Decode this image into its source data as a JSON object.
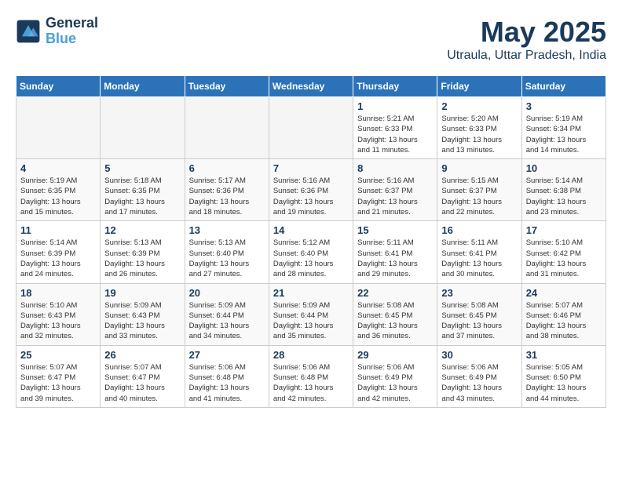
{
  "header": {
    "logo_line1": "General",
    "logo_line2": "Blue",
    "title": "May 2025",
    "subtitle": "Utraula, Uttar Pradesh, India"
  },
  "days_of_week": [
    "Sunday",
    "Monday",
    "Tuesday",
    "Wednesday",
    "Thursday",
    "Friday",
    "Saturday"
  ],
  "weeks": [
    [
      {
        "num": "",
        "info": ""
      },
      {
        "num": "",
        "info": ""
      },
      {
        "num": "",
        "info": ""
      },
      {
        "num": "",
        "info": ""
      },
      {
        "num": "1",
        "info": "Sunrise: 5:21 AM\nSunset: 6:33 PM\nDaylight: 13 hours\nand 11 minutes."
      },
      {
        "num": "2",
        "info": "Sunrise: 5:20 AM\nSunset: 6:33 PM\nDaylight: 13 hours\nand 13 minutes."
      },
      {
        "num": "3",
        "info": "Sunrise: 5:19 AM\nSunset: 6:34 PM\nDaylight: 13 hours\nand 14 minutes."
      }
    ],
    [
      {
        "num": "4",
        "info": "Sunrise: 5:19 AM\nSunset: 6:35 PM\nDaylight: 13 hours\nand 15 minutes."
      },
      {
        "num": "5",
        "info": "Sunrise: 5:18 AM\nSunset: 6:35 PM\nDaylight: 13 hours\nand 17 minutes."
      },
      {
        "num": "6",
        "info": "Sunrise: 5:17 AM\nSunset: 6:36 PM\nDaylight: 13 hours\nand 18 minutes."
      },
      {
        "num": "7",
        "info": "Sunrise: 5:16 AM\nSunset: 6:36 PM\nDaylight: 13 hours\nand 19 minutes."
      },
      {
        "num": "8",
        "info": "Sunrise: 5:16 AM\nSunset: 6:37 PM\nDaylight: 13 hours\nand 21 minutes."
      },
      {
        "num": "9",
        "info": "Sunrise: 5:15 AM\nSunset: 6:37 PM\nDaylight: 13 hours\nand 22 minutes."
      },
      {
        "num": "10",
        "info": "Sunrise: 5:14 AM\nSunset: 6:38 PM\nDaylight: 13 hours\nand 23 minutes."
      }
    ],
    [
      {
        "num": "11",
        "info": "Sunrise: 5:14 AM\nSunset: 6:39 PM\nDaylight: 13 hours\nand 24 minutes."
      },
      {
        "num": "12",
        "info": "Sunrise: 5:13 AM\nSunset: 6:39 PM\nDaylight: 13 hours\nand 26 minutes."
      },
      {
        "num": "13",
        "info": "Sunrise: 5:13 AM\nSunset: 6:40 PM\nDaylight: 13 hours\nand 27 minutes."
      },
      {
        "num": "14",
        "info": "Sunrise: 5:12 AM\nSunset: 6:40 PM\nDaylight: 13 hours\nand 28 minutes."
      },
      {
        "num": "15",
        "info": "Sunrise: 5:11 AM\nSunset: 6:41 PM\nDaylight: 13 hours\nand 29 minutes."
      },
      {
        "num": "16",
        "info": "Sunrise: 5:11 AM\nSunset: 6:41 PM\nDaylight: 13 hours\nand 30 minutes."
      },
      {
        "num": "17",
        "info": "Sunrise: 5:10 AM\nSunset: 6:42 PM\nDaylight: 13 hours\nand 31 minutes."
      }
    ],
    [
      {
        "num": "18",
        "info": "Sunrise: 5:10 AM\nSunset: 6:43 PM\nDaylight: 13 hours\nand 32 minutes."
      },
      {
        "num": "19",
        "info": "Sunrise: 5:09 AM\nSunset: 6:43 PM\nDaylight: 13 hours\nand 33 minutes."
      },
      {
        "num": "20",
        "info": "Sunrise: 5:09 AM\nSunset: 6:44 PM\nDaylight: 13 hours\nand 34 minutes."
      },
      {
        "num": "21",
        "info": "Sunrise: 5:09 AM\nSunset: 6:44 PM\nDaylight: 13 hours\nand 35 minutes."
      },
      {
        "num": "22",
        "info": "Sunrise: 5:08 AM\nSunset: 6:45 PM\nDaylight: 13 hours\nand 36 minutes."
      },
      {
        "num": "23",
        "info": "Sunrise: 5:08 AM\nSunset: 6:45 PM\nDaylight: 13 hours\nand 37 minutes."
      },
      {
        "num": "24",
        "info": "Sunrise: 5:07 AM\nSunset: 6:46 PM\nDaylight: 13 hours\nand 38 minutes."
      }
    ],
    [
      {
        "num": "25",
        "info": "Sunrise: 5:07 AM\nSunset: 6:47 PM\nDaylight: 13 hours\nand 39 minutes."
      },
      {
        "num": "26",
        "info": "Sunrise: 5:07 AM\nSunset: 6:47 PM\nDaylight: 13 hours\nand 40 minutes."
      },
      {
        "num": "27",
        "info": "Sunrise: 5:06 AM\nSunset: 6:48 PM\nDaylight: 13 hours\nand 41 minutes."
      },
      {
        "num": "28",
        "info": "Sunrise: 5:06 AM\nSunset: 6:48 PM\nDaylight: 13 hours\nand 42 minutes."
      },
      {
        "num": "29",
        "info": "Sunrise: 5:06 AM\nSunset: 6:49 PM\nDaylight: 13 hours\nand 42 minutes."
      },
      {
        "num": "30",
        "info": "Sunrise: 5:06 AM\nSunset: 6:49 PM\nDaylight: 13 hours\nand 43 minutes."
      },
      {
        "num": "31",
        "info": "Sunrise: 5:05 AM\nSunset: 6:50 PM\nDaylight: 13 hours\nand 44 minutes."
      }
    ]
  ]
}
